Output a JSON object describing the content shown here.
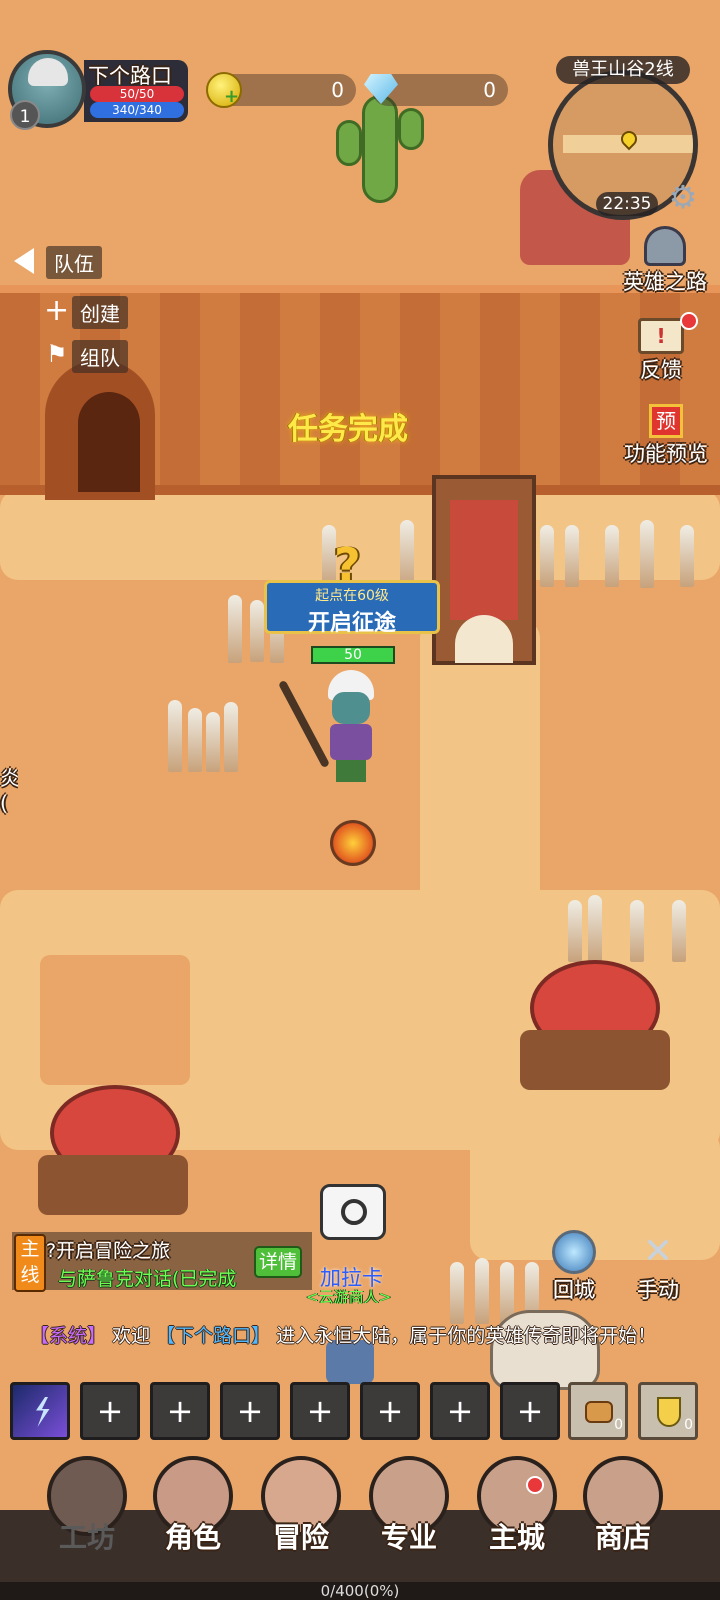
{
  "player": {
    "name": "下个路口",
    "level": "1",
    "hp": "50/50",
    "mp": "340/340",
    "hp_fraction": 1.0,
    "mp_fraction": 1.0
  },
  "resources": {
    "gold": "0",
    "diamonds": "0"
  },
  "minimap": {
    "title": "兽王山谷2线",
    "time": "22:35"
  },
  "team": {
    "header": "队伍",
    "create": "创建",
    "group": "组队"
  },
  "side_buttons": {
    "hero_road": "英雄之路",
    "feedback": "反馈",
    "preview": "功能预览",
    "preview_badge": "预"
  },
  "world": {
    "mission_complete": "任务完成",
    "quest_banner_top": "起点在60级",
    "quest_banner_main": "开启征途",
    "player_hp": "50",
    "npc_name": "加拉卡",
    "npc_title": "<云游商人>",
    "edge_text": "炎("
  },
  "quest": {
    "tag_line1": "主",
    "tag_line2": "线",
    "title": "?开启冒险之旅",
    "objective": "与萨鲁克对话(已完成",
    "details": "详情"
  },
  "action_buttons": {
    "return_city": "回城",
    "manual": "手动"
  },
  "chat": {
    "channel": "【系统】",
    "text1": "欢迎",
    "player_tag": "【下个路口】",
    "text2": "进入永恒大陆，属于你的英雄传奇即将开始！"
  },
  "skill_bar": {
    "empty_slot": "+",
    "item1_count": "0",
    "item2_count": "0"
  },
  "nav": [
    "工坊",
    "角色",
    "冒险",
    "专业",
    "主城",
    "商店"
  ],
  "xp": {
    "text": "0/400(0%)",
    "fraction": 0
  },
  "colors": {
    "ground": "#e9a668",
    "hp": "#d8323a",
    "mp": "#2f6fe0",
    "mission": "#ffe94a",
    "quest_tag": "#f08a1a",
    "green_text": "#6bff52"
  }
}
